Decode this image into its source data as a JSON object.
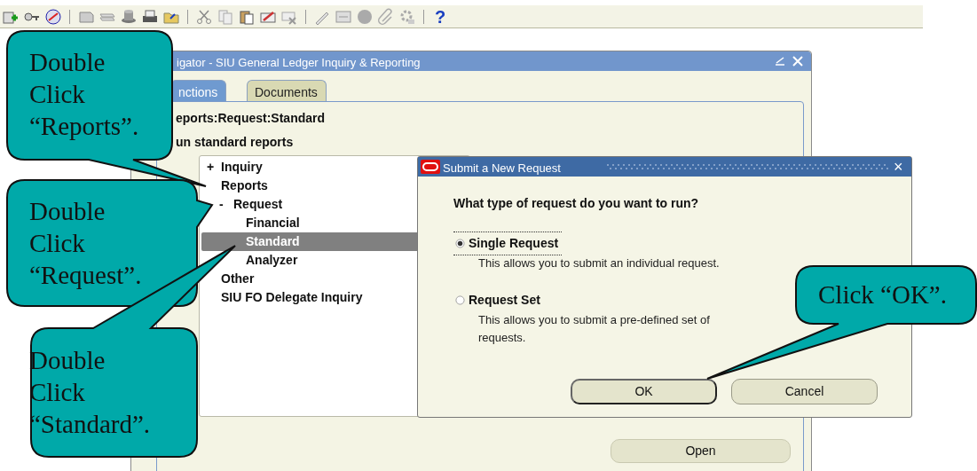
{
  "toolbar": {
    "help": "?"
  },
  "navigator": {
    "title": "igator - SIU General Ledger Inquiry & Reporting",
    "tabs": [
      {
        "label": "nctions",
        "selected": true
      },
      {
        "label": "Documents",
        "selected": false
      }
    ],
    "path": "eports:Request:Standard",
    "description": "un standard reports",
    "tree": [
      {
        "label": "Inquiry",
        "marker": "+",
        "selected": false
      },
      {
        "label": "Reports",
        "selected": false,
        "children": [
          {
            "label": "Request",
            "marker": "-",
            "selected": false,
            "children": [
              {
                "label": "Financial",
                "selected": false
              },
              {
                "label": "Standard",
                "selected": true
              },
              {
                "label": "Analyzer",
                "selected": false
              }
            ]
          }
        ]
      },
      {
        "label": "Other",
        "selected": false
      },
      {
        "label": "SIU FO Delegate Inquiry",
        "selected": false
      }
    ],
    "open_button": "Open"
  },
  "dialog": {
    "title": "Submit a New Request",
    "close": "×",
    "question": "What type of request do you want to run?",
    "options": [
      {
        "label": "Single Request",
        "description": "This allows you to submit an individual request.",
        "selected": true
      },
      {
        "label": "Request Set",
        "description": "This allows you to submit a pre-defined set of requests.",
        "selected": false
      }
    ],
    "buttons": [
      {
        "label": "OK",
        "default": true
      },
      {
        "label": "Cancel",
        "default": false
      }
    ]
  },
  "callouts": [
    {
      "lines": [
        "Double",
        "Click",
        "“Reports”."
      ]
    },
    {
      "lines": [
        "Double",
        "Click",
        "“Request”."
      ]
    },
    {
      "lines": [
        "Double",
        "Click",
        "“Standard”."
      ]
    },
    {
      "lines": [
        "Click “OK”."
      ]
    }
  ]
}
